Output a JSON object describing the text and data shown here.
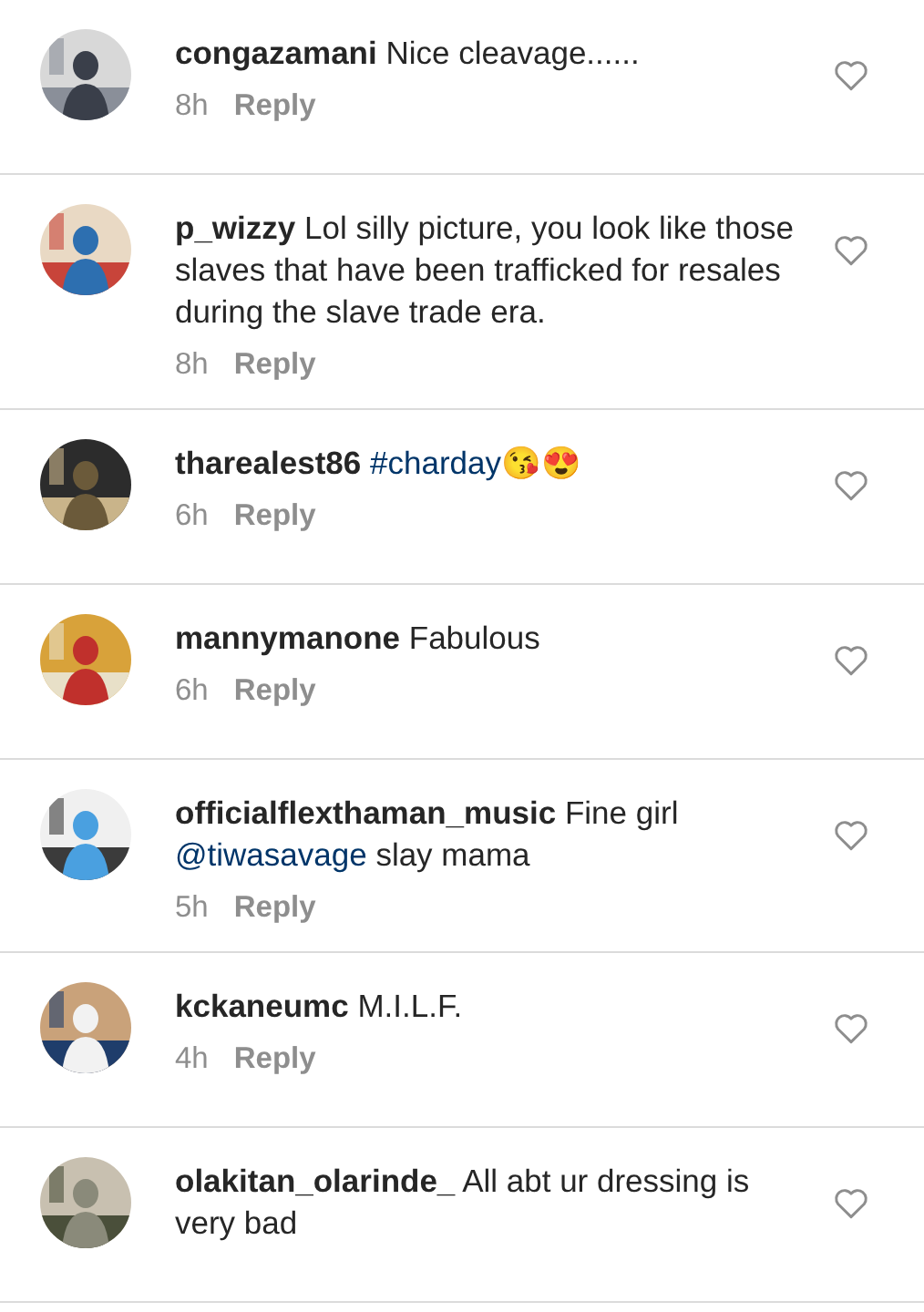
{
  "comments": [
    {
      "username": "congazamani",
      "parts": [
        {
          "kind": "text",
          "text": "Nice cleavage......"
        }
      ],
      "time": "8h",
      "reply": "Reply",
      "liked": false,
      "avatar": {
        "kind": "picture"
      }
    },
    {
      "username": "p_wizzy",
      "parts": [
        {
          "kind": "text",
          "text": "Lol silly picture, you look like those slaves that have been trafficked for resales during the slave trade era."
        }
      ],
      "time": "8h",
      "reply": "Reply",
      "liked": false,
      "avatar": {
        "kind": "picture"
      }
    },
    {
      "username": "tharealest86",
      "parts": [
        {
          "kind": "link",
          "text": "#charday"
        },
        {
          "kind": "text",
          "text": "😘😍"
        }
      ],
      "time": "6h",
      "reply": "Reply",
      "liked": false,
      "avatar": {
        "kind": "picture"
      }
    },
    {
      "username": "mannymanone",
      "parts": [
        {
          "kind": "text",
          "text": "Fabulous"
        }
      ],
      "time": "6h",
      "reply": "Reply",
      "liked": false,
      "avatar": {
        "kind": "picture"
      }
    },
    {
      "username": "officialflexthaman_music",
      "parts": [
        {
          "kind": "text",
          "text": "Fine girl "
        },
        {
          "kind": "link",
          "text": "@tiwasavage"
        },
        {
          "kind": "text",
          "text": " slay mama"
        }
      ],
      "time": "5h",
      "reply": "Reply",
      "liked": false,
      "avatar": {
        "kind": "picture"
      }
    },
    {
      "username": "kckaneumc",
      "parts": [
        {
          "kind": "text",
          "text": "M.I.L.F."
        }
      ],
      "time": "4h",
      "reply": "Reply",
      "liked": false,
      "avatar": {
        "kind": "picture"
      }
    },
    {
      "username": "olakitan_olarinde_",
      "parts": [
        {
          "kind": "text",
          "text": "All abt ur dressing is very bad"
        }
      ],
      "liked": false,
      "avatar": {
        "kind": "picture"
      }
    }
  ]
}
